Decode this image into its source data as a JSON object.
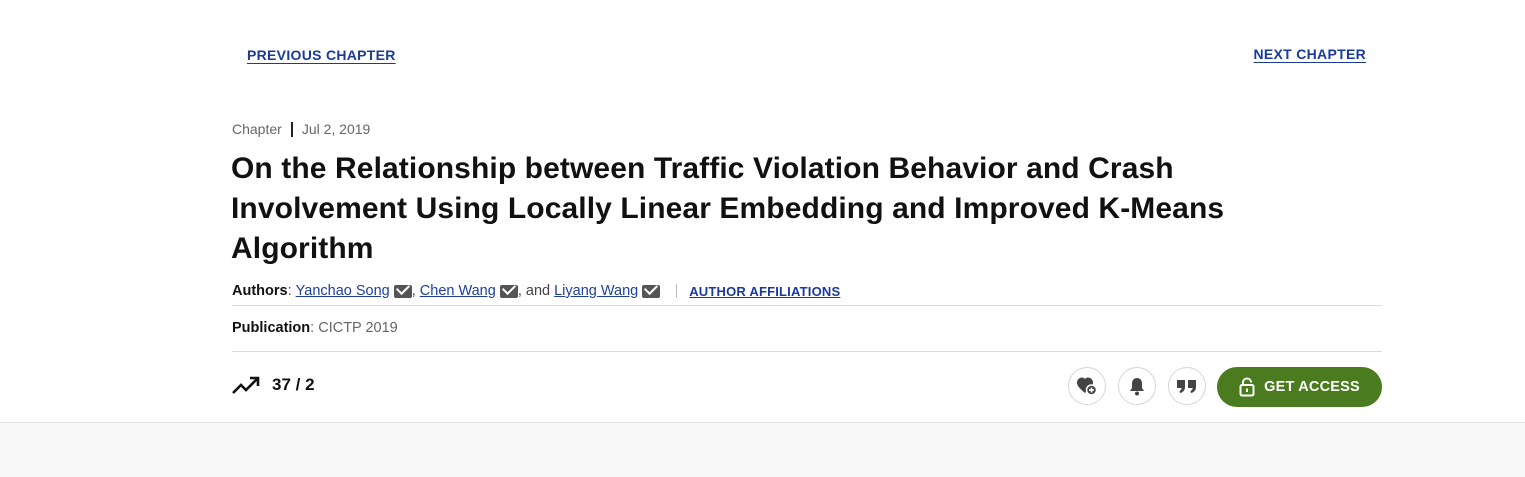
{
  "nav": {
    "previous_label": "PREVIOUS CHAPTER",
    "next_label": "NEXT CHAPTER"
  },
  "meta": {
    "type": "Chapter",
    "date": "Jul 2, 2019"
  },
  "title": "On the Relationship between Traffic Violation Behavior and Crash Involvement Using Locally Linear Embedding and Improved K-Means Algorithm",
  "authors": {
    "label": "Authors",
    "list": [
      "Yanchao Song",
      "Chen Wang",
      "Liyang Wang"
    ],
    "separator_comma": ",",
    "separator_and": ", and",
    "affiliations_label": "AUTHOR AFFILIATIONS"
  },
  "publication": {
    "label": "Publication",
    "value": "CICTP 2019"
  },
  "metrics": {
    "value": "37 / 2",
    "icon": "trending-up-icon"
  },
  "actions": {
    "favorite_icon": "heart-plus-icon",
    "alert_icon": "bell-icon",
    "cite_icon": "quote-icon",
    "access_label": "GET ACCESS",
    "access_color": "#4a7b1e"
  }
}
